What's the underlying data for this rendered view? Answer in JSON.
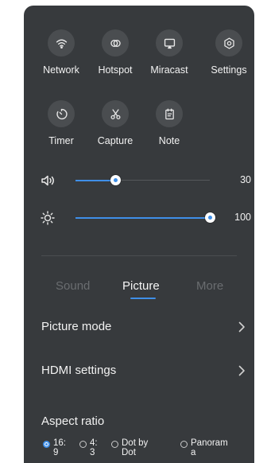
{
  "quick_actions": [
    {
      "label": "Network",
      "icon": "wifi-icon"
    },
    {
      "label": "Hotspot",
      "icon": "hotspot-icon"
    },
    {
      "label": "Miracast",
      "icon": "cast-icon"
    },
    {
      "label": "Settings",
      "icon": "gear-icon"
    },
    {
      "label": "Timer",
      "icon": "timer-icon"
    },
    {
      "label": "Capture",
      "icon": "scissors-icon"
    },
    {
      "label": "Note",
      "icon": "note-icon"
    }
  ],
  "sliders": {
    "volume": {
      "value": "30",
      "level": 0.3,
      "icon": "speaker-icon"
    },
    "brightness": {
      "value": "100",
      "level": 1.0,
      "icon": "sun-icon"
    }
  },
  "tabs": [
    {
      "label": "Sound",
      "active": false
    },
    {
      "label": "Picture",
      "active": true
    },
    {
      "label": "More",
      "active": false
    }
  ],
  "menu": [
    {
      "label": "Picture mode"
    },
    {
      "label": "HDMI settings"
    }
  ],
  "aspect": {
    "title": "Aspect ratio",
    "options": [
      {
        "line1": "16:",
        "line2": "9",
        "selected": true
      },
      {
        "line1": "4:",
        "line2": "3",
        "selected": false
      },
      {
        "line1": "Dot by",
        "line2": "Dot",
        "selected": false
      },
      {
        "line1": "Panoram",
        "line2": "a",
        "selected": false
      }
    ]
  },
  "colors": {
    "panel": "#373a3d",
    "accent": "#3f8fe8",
    "button": "#4a4d50"
  }
}
